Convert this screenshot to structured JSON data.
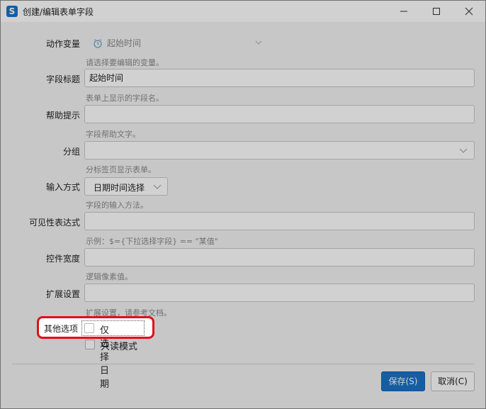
{
  "window": {
    "title": "创建/编辑表单字段"
  },
  "fields": {
    "action_variable": {
      "label": "动作变量",
      "value": "起始时间",
      "hint": "请选择要编辑的变量。"
    },
    "field_title": {
      "label": "字段标题",
      "value": "起始时间",
      "hint": "表单上显示的字段名。"
    },
    "help_tip": {
      "label": "帮助提示",
      "value": "",
      "hint": "字段帮助文字。"
    },
    "group": {
      "label": "分组",
      "value": "",
      "hint": "分标签页显示表单。"
    },
    "input_mode": {
      "label": "输入方式",
      "value": "日期时间选择",
      "hint": "字段的输入方法。"
    },
    "visibility_expr": {
      "label": "可见性表达式",
      "value": "",
      "hint": "示例：$={下拉选择字段} == \"某值\""
    },
    "control_width": {
      "label": "控件宽度",
      "value": "",
      "hint": "逻辑像素值。"
    },
    "extend_settings": {
      "label": "扩展设置",
      "value": "",
      "hint": "扩展设置，请参考文档。"
    },
    "other_options": {
      "label": "其他选项",
      "options": [
        {
          "label": "仅选择日期",
          "checked": false
        },
        {
          "label": "只读模式",
          "checked": false
        }
      ]
    }
  },
  "buttons": {
    "save": "保存(S)",
    "cancel": "取消(C)"
  },
  "icons": {
    "app": "app-logo-icon",
    "variable": "alarm-clock-icon",
    "minimize": "minimize-icon",
    "maximize": "maximize-icon",
    "close": "close-icon"
  },
  "colors": {
    "accent": "#1a73c9",
    "highlight": "#e0101a"
  }
}
